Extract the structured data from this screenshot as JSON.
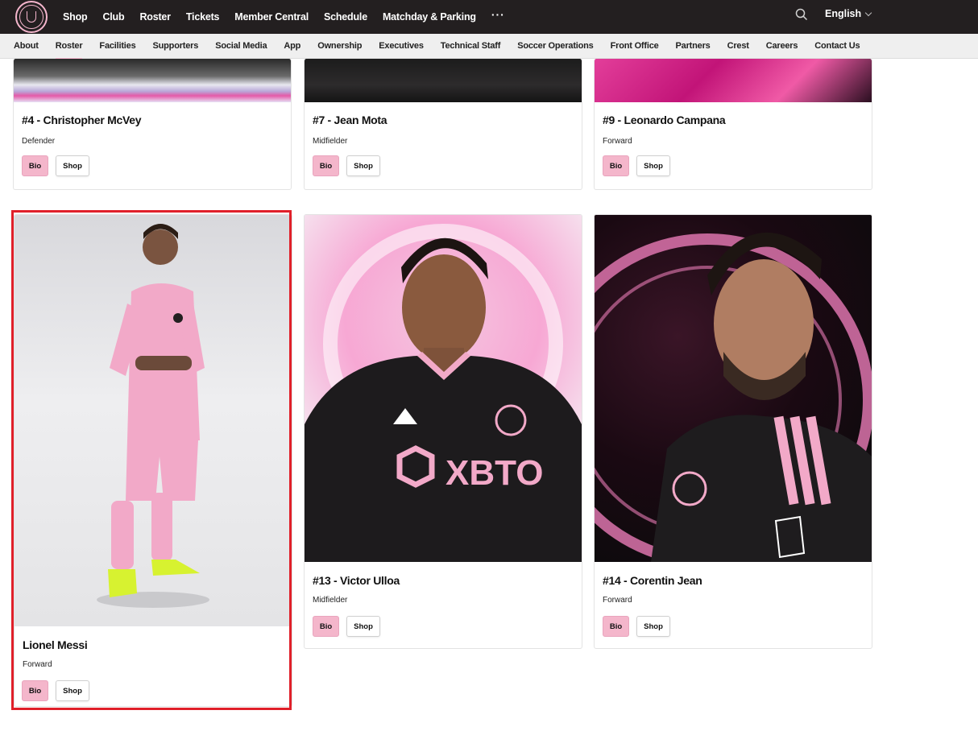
{
  "topnav": {
    "logo_alt": "Inter Miami CF crest",
    "items": [
      "Shop",
      "Club",
      "Roster",
      "Tickets",
      "Member Central",
      "Schedule",
      "Matchday & Parking"
    ],
    "more": "···",
    "language": "English"
  },
  "subnav": {
    "items": [
      "About",
      "Roster",
      "Facilities",
      "Supporters",
      "Social Media",
      "App",
      "Ownership",
      "Executives",
      "Technical Staff",
      "Soccer Operations",
      "Front Office",
      "Partners",
      "Crest",
      "Careers",
      "Contact Us"
    ],
    "active": "Roster"
  },
  "players": [
    {
      "name": "#4 - Christopher McVey",
      "position": "Defender",
      "bio": "Bio",
      "shop": "Shop"
    },
    {
      "name": "#7 - Jean Mota",
      "position": "Midfielder",
      "bio": "Bio",
      "shop": "Shop"
    },
    {
      "name": "#9 - Leonardo Campana",
      "position": "Forward",
      "bio": "Bio",
      "shop": "Shop"
    },
    {
      "name": "Lionel Messi",
      "position": "Forward",
      "bio": "Bio",
      "shop": "Shop"
    },
    {
      "name": "#13 - Victor Ulloa",
      "position": "Midfielder",
      "bio": "Bio",
      "shop": "Shop"
    },
    {
      "name": "#14 - Corentin Jean",
      "position": "Forward",
      "bio": "Bio",
      "shop": "Shop"
    }
  ],
  "colors": {
    "topnav_bg": "#231f20",
    "accent_pink": "#f4b6cb",
    "highlight_red": "#e0202a"
  }
}
